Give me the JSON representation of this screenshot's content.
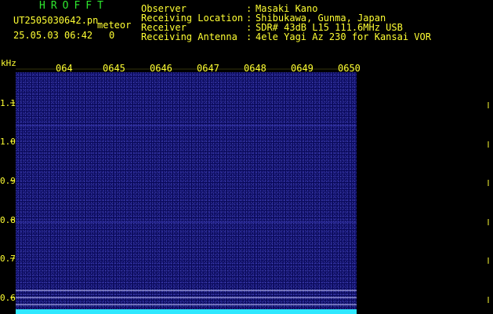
{
  "header": {
    "logo": "HROFFT",
    "filename": "UT2505030642.pn",
    "datetime": "25.05.03 06:42",
    "meteor_label": "meteor",
    "meteor_count": "0",
    "info": [
      {
        "key": "Observer",
        "value": "Masaki Kano"
      },
      {
        "key": "Receiving Location",
        "value": "Shibukawa, Gunma, Japan"
      },
      {
        "key": "Receiver",
        "value": "SDR# 43dB L15 111.6MHz USB"
      },
      {
        "key": "Receiving Antenna",
        "value": "4ele Yagi Az 230 for Kansai VOR"
      }
    ],
    "separator": ":"
  },
  "axis": {
    "unit": "kHz",
    "x_ticks": [
      "064",
      "0645",
      "0646",
      "0647",
      "0648",
      "0649",
      "0650"
    ],
    "y_ticks": [
      "1.1",
      "1.0",
      "0.9",
      "0.8",
      "0.7",
      "0.6"
    ]
  },
  "colors": {
    "label": "#ffff33",
    "logo": "#2ee82e",
    "background": "#0a0a5c"
  }
}
